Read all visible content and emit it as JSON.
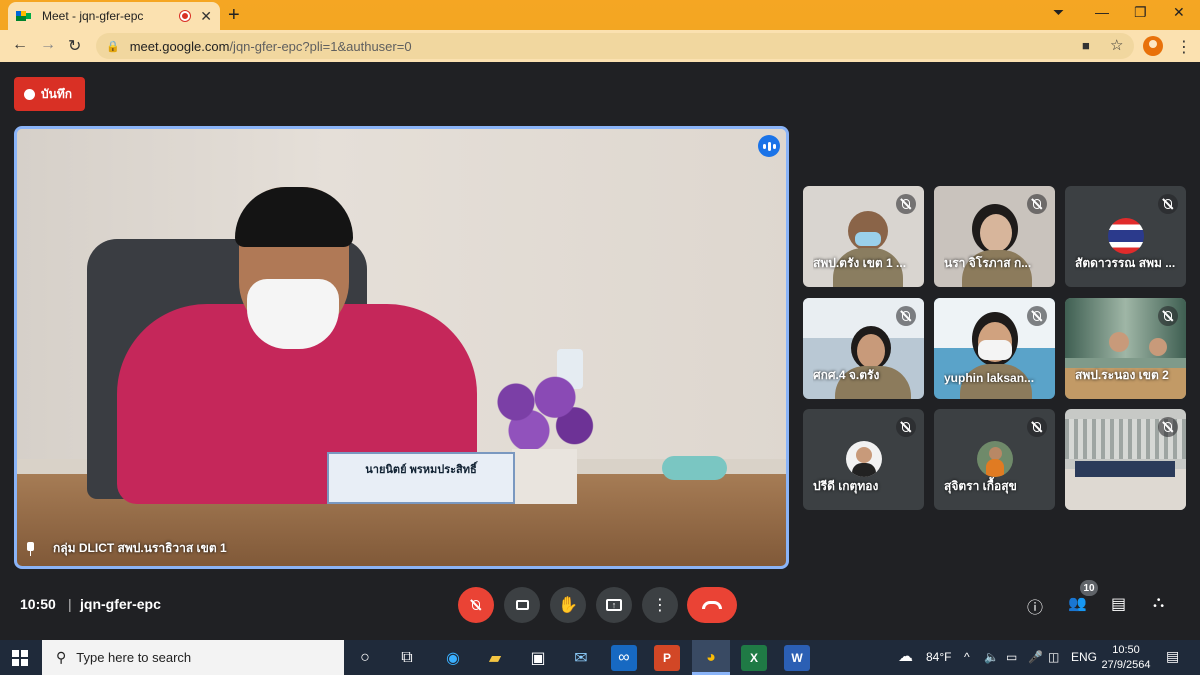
{
  "browser": {
    "tab_title": "Meet - jqn-gfer-epc",
    "url_host": "meet.google.com",
    "url_path": "/jqn-gfer-epc?pli=1&authuser=0"
  },
  "meet": {
    "record_label": "บันทึก",
    "main_speaker_label": "กลุ่ม DLICT สพป.นราธิวาส เขต 1",
    "nameplate_text": "นายนิตย์  พรหมประสิทธิ์",
    "time": "10:50",
    "meeting_code": "jqn-gfer-epc",
    "participant_count": "10",
    "tiles": [
      {
        "name": "สพป.ตรัง เขต 1 ..."
      },
      {
        "name": "นรา จิโรภาส ก..."
      },
      {
        "name": "สัตดาวรรณ สพม ..."
      },
      {
        "name": "ศกศ.4 จ.ตรัง"
      },
      {
        "name": "yuphin laksan..."
      },
      {
        "name": "สพป.ระนอง เขต 2"
      },
      {
        "name": "ปรีดี เกตุทอง"
      },
      {
        "name": "สุจิตรา เกื้อสุข"
      },
      {
        "name": ""
      }
    ]
  },
  "taskbar": {
    "search_placeholder": "Type here to search",
    "weather": "84°F",
    "language": "ENG",
    "clock_time": "10:50",
    "clock_date": "27/9/2564"
  },
  "colors": {
    "accent_red": "#ea4335",
    "active_border": "#8ab4f8",
    "tab_strip": "#f5a623"
  }
}
